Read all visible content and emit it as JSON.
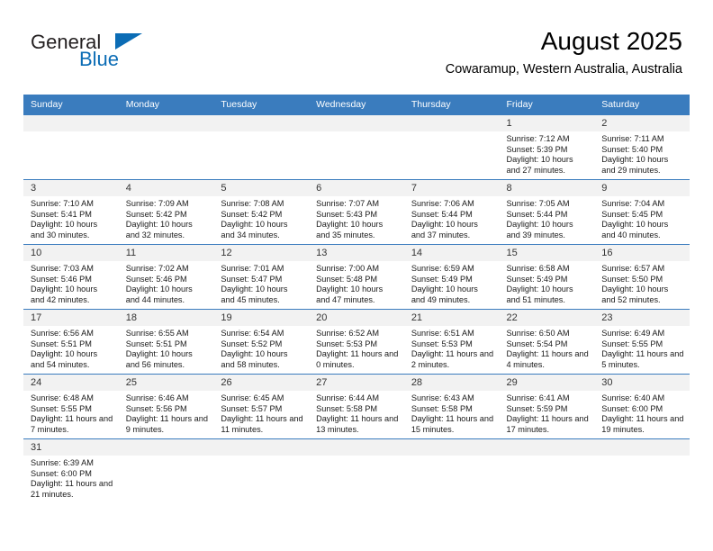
{
  "logo": {
    "word_top": "General",
    "word_bottom": "Blue",
    "triangle_icon": "blue-triangle-icon"
  },
  "header": {
    "title": "August 2025",
    "subtitle": "Cowaramup, Western Australia, Australia"
  },
  "colors": {
    "header_blue": "#3a7cbe",
    "logo_blue": "#0b6cb5",
    "daynum_band": "#f2f2f2"
  },
  "calendar": {
    "weekday_headers": [
      "Sunday",
      "Monday",
      "Tuesday",
      "Wednesday",
      "Thursday",
      "Friday",
      "Saturday"
    ],
    "weeks": [
      [
        {
          "empty": true
        },
        {
          "empty": true
        },
        {
          "empty": true
        },
        {
          "empty": true
        },
        {
          "empty": true
        },
        {
          "day": "1",
          "sunrise": "Sunrise: 7:12 AM",
          "sunset": "Sunset: 5:39 PM",
          "daylight": "Daylight: 10 hours and 27 minutes."
        },
        {
          "day": "2",
          "sunrise": "Sunrise: 7:11 AM",
          "sunset": "Sunset: 5:40 PM",
          "daylight": "Daylight: 10 hours and 29 minutes."
        }
      ],
      [
        {
          "day": "3",
          "sunrise": "Sunrise: 7:10 AM",
          "sunset": "Sunset: 5:41 PM",
          "daylight": "Daylight: 10 hours and 30 minutes."
        },
        {
          "day": "4",
          "sunrise": "Sunrise: 7:09 AM",
          "sunset": "Sunset: 5:42 PM",
          "daylight": "Daylight: 10 hours and 32 minutes."
        },
        {
          "day": "5",
          "sunrise": "Sunrise: 7:08 AM",
          "sunset": "Sunset: 5:42 PM",
          "daylight": "Daylight: 10 hours and 34 minutes."
        },
        {
          "day": "6",
          "sunrise": "Sunrise: 7:07 AM",
          "sunset": "Sunset: 5:43 PM",
          "daylight": "Daylight: 10 hours and 35 minutes."
        },
        {
          "day": "7",
          "sunrise": "Sunrise: 7:06 AM",
          "sunset": "Sunset: 5:44 PM",
          "daylight": "Daylight: 10 hours and 37 minutes."
        },
        {
          "day": "8",
          "sunrise": "Sunrise: 7:05 AM",
          "sunset": "Sunset: 5:44 PM",
          "daylight": "Daylight: 10 hours and 39 minutes."
        },
        {
          "day": "9",
          "sunrise": "Sunrise: 7:04 AM",
          "sunset": "Sunset: 5:45 PM",
          "daylight": "Daylight: 10 hours and 40 minutes."
        }
      ],
      [
        {
          "day": "10",
          "sunrise": "Sunrise: 7:03 AM",
          "sunset": "Sunset: 5:46 PM",
          "daylight": "Daylight: 10 hours and 42 minutes."
        },
        {
          "day": "11",
          "sunrise": "Sunrise: 7:02 AM",
          "sunset": "Sunset: 5:46 PM",
          "daylight": "Daylight: 10 hours and 44 minutes."
        },
        {
          "day": "12",
          "sunrise": "Sunrise: 7:01 AM",
          "sunset": "Sunset: 5:47 PM",
          "daylight": "Daylight: 10 hours and 45 minutes."
        },
        {
          "day": "13",
          "sunrise": "Sunrise: 7:00 AM",
          "sunset": "Sunset: 5:48 PM",
          "daylight": "Daylight: 10 hours and 47 minutes."
        },
        {
          "day": "14",
          "sunrise": "Sunrise: 6:59 AM",
          "sunset": "Sunset: 5:49 PM",
          "daylight": "Daylight: 10 hours and 49 minutes."
        },
        {
          "day": "15",
          "sunrise": "Sunrise: 6:58 AM",
          "sunset": "Sunset: 5:49 PM",
          "daylight": "Daylight: 10 hours and 51 minutes."
        },
        {
          "day": "16",
          "sunrise": "Sunrise: 6:57 AM",
          "sunset": "Sunset: 5:50 PM",
          "daylight": "Daylight: 10 hours and 52 minutes."
        }
      ],
      [
        {
          "day": "17",
          "sunrise": "Sunrise: 6:56 AM",
          "sunset": "Sunset: 5:51 PM",
          "daylight": "Daylight: 10 hours and 54 minutes."
        },
        {
          "day": "18",
          "sunrise": "Sunrise: 6:55 AM",
          "sunset": "Sunset: 5:51 PM",
          "daylight": "Daylight: 10 hours and 56 minutes."
        },
        {
          "day": "19",
          "sunrise": "Sunrise: 6:54 AM",
          "sunset": "Sunset: 5:52 PM",
          "daylight": "Daylight: 10 hours and 58 minutes."
        },
        {
          "day": "20",
          "sunrise": "Sunrise: 6:52 AM",
          "sunset": "Sunset: 5:53 PM",
          "daylight": "Daylight: 11 hours and 0 minutes."
        },
        {
          "day": "21",
          "sunrise": "Sunrise: 6:51 AM",
          "sunset": "Sunset: 5:53 PM",
          "daylight": "Daylight: 11 hours and 2 minutes."
        },
        {
          "day": "22",
          "sunrise": "Sunrise: 6:50 AM",
          "sunset": "Sunset: 5:54 PM",
          "daylight": "Daylight: 11 hours and 4 minutes."
        },
        {
          "day": "23",
          "sunrise": "Sunrise: 6:49 AM",
          "sunset": "Sunset: 5:55 PM",
          "daylight": "Daylight: 11 hours and 5 minutes."
        }
      ],
      [
        {
          "day": "24",
          "sunrise": "Sunrise: 6:48 AM",
          "sunset": "Sunset: 5:55 PM",
          "daylight": "Daylight: 11 hours and 7 minutes."
        },
        {
          "day": "25",
          "sunrise": "Sunrise: 6:46 AM",
          "sunset": "Sunset: 5:56 PM",
          "daylight": "Daylight: 11 hours and 9 minutes."
        },
        {
          "day": "26",
          "sunrise": "Sunrise: 6:45 AM",
          "sunset": "Sunset: 5:57 PM",
          "daylight": "Daylight: 11 hours and 11 minutes."
        },
        {
          "day": "27",
          "sunrise": "Sunrise: 6:44 AM",
          "sunset": "Sunset: 5:58 PM",
          "daylight": "Daylight: 11 hours and 13 minutes."
        },
        {
          "day": "28",
          "sunrise": "Sunrise: 6:43 AM",
          "sunset": "Sunset: 5:58 PM",
          "daylight": "Daylight: 11 hours and 15 minutes."
        },
        {
          "day": "29",
          "sunrise": "Sunrise: 6:41 AM",
          "sunset": "Sunset: 5:59 PM",
          "daylight": "Daylight: 11 hours and 17 minutes."
        },
        {
          "day": "30",
          "sunrise": "Sunrise: 6:40 AM",
          "sunset": "Sunset: 6:00 PM",
          "daylight": "Daylight: 11 hours and 19 minutes."
        }
      ],
      [
        {
          "day": "31",
          "sunrise": "Sunrise: 6:39 AM",
          "sunset": "Sunset: 6:00 PM",
          "daylight": "Daylight: 11 hours and 21 minutes."
        },
        {
          "empty": true
        },
        {
          "empty": true
        },
        {
          "empty": true
        },
        {
          "empty": true
        },
        {
          "empty": true
        },
        {
          "empty": true
        }
      ]
    ]
  }
}
